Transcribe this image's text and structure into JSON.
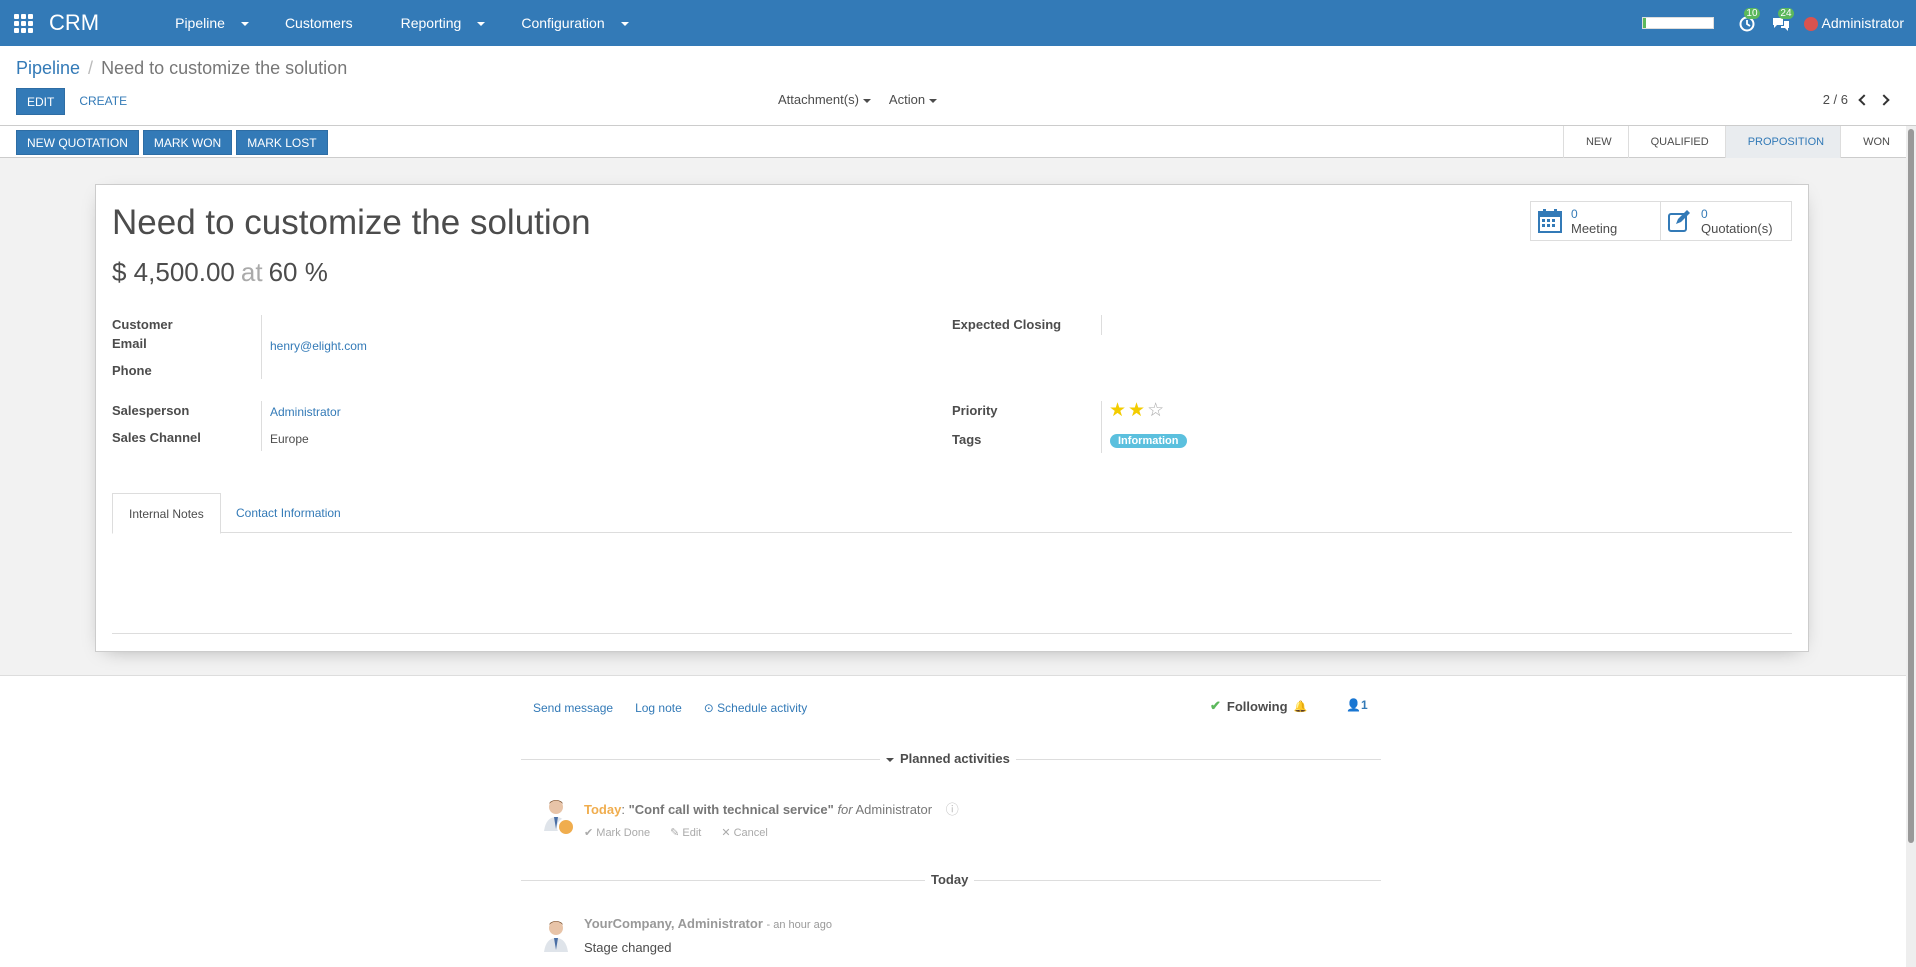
{
  "topbar": {
    "app_name": "CRM",
    "menu": [
      {
        "label": "Pipeline",
        "dropdown": true
      },
      {
        "label": "Customers",
        "dropdown": false
      },
      {
        "label": "Reporting",
        "dropdown": true
      },
      {
        "label": "Configuration",
        "dropdown": true
      }
    ],
    "activity_count": "10",
    "messages_count": "24",
    "user": "Administrator",
    "progress_fraction": 0.05
  },
  "control_panel": {
    "breadcrumb_root": "Pipeline",
    "breadcrumb_sep": "/",
    "breadcrumb_current": "Need to customize the solution",
    "edit_label": "EDIT",
    "create_label": "CREATE",
    "attachments_label": "Attachment(s)",
    "action_label": "Action",
    "pager": "2 / 6"
  },
  "statusbar": {
    "buttons": [
      "NEW QUOTATION",
      "MARK WON",
      "MARK LOST"
    ],
    "stages": [
      "NEW",
      "QUALIFIED",
      "PROPOSITION",
      "WON"
    ],
    "active_stage": "PROPOSITION"
  },
  "form": {
    "title": "Need to customize the solution",
    "revenue": "$ 4,500.00",
    "at": "at",
    "probability": "60 %",
    "smart_buttons": [
      {
        "count": "0",
        "label": "Meeting",
        "icon": "calendar-icon"
      },
      {
        "count": "0",
        "label": "Quotation(s)",
        "icon": "edit-icon"
      }
    ],
    "labels": {
      "customer": "Customer",
      "email": "Email",
      "phone": "Phone",
      "salesperson": "Salesperson",
      "sales_channel": "Sales Channel",
      "expected_closing": "Expected Closing",
      "priority": "Priority",
      "tags": "Tags"
    },
    "values": {
      "email": "henry@elight.com",
      "salesperson": "Administrator",
      "sales_channel": "Europe",
      "priority_stars": 2,
      "priority_max": 3,
      "tag": "Information"
    },
    "tabs": [
      "Internal Notes",
      "Contact Information"
    ],
    "active_tab": "Internal Notes"
  },
  "chatter": {
    "send_message": "Send message",
    "log_note": "Log note",
    "schedule_activity": "Schedule activity",
    "following": "Following",
    "followers": "1",
    "planned_activities": "Planned activities",
    "activity": {
      "when": "Today",
      "colon": ":",
      "summary": "\"Conf call with technical service\"",
      "for": "for",
      "assignee": "Administrator",
      "mark_done": "Mark Done",
      "edit": "Edit",
      "cancel": "Cancel"
    },
    "today_separator": "Today",
    "message": {
      "author": "YourCompany, Administrator",
      "time": "- an hour ago",
      "body": "Stage changed"
    }
  },
  "colors": {
    "primary": "#337ab7",
    "success": "#5cb85c",
    "warning": "#f0ad4e",
    "tag": "#5bc0de",
    "star": "#f3cc00"
  }
}
